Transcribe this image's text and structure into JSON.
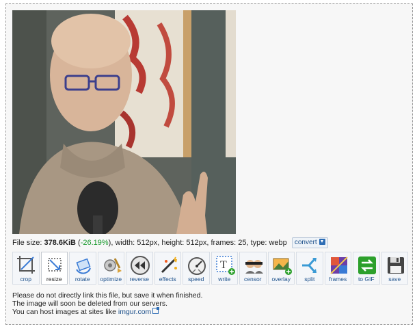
{
  "file_info": {
    "prefix": "File size: ",
    "size": "378.6KiB",
    "paren_open": " (",
    "percent": "-26.19%",
    "rest": "), width: 512px, height: 512px, frames: 25, type: webp"
  },
  "convert_label": "convert",
  "tools": [
    {
      "label": "crop",
      "icon": "crop-icon"
    },
    {
      "label": "resize",
      "icon": "resize-icon"
    },
    {
      "label": "rotate",
      "icon": "rotate-icon"
    },
    {
      "label": "optimize",
      "icon": "optimize-icon"
    },
    {
      "label": "reverse",
      "icon": "reverse-icon"
    },
    {
      "label": "effects",
      "icon": "effects-icon"
    },
    {
      "label": "speed",
      "icon": "speed-icon"
    },
    {
      "label": "write",
      "icon": "write-icon"
    },
    {
      "label": "censor",
      "icon": "censor-icon"
    },
    {
      "label": "overlay",
      "icon": "overlay-icon"
    },
    {
      "label": "split",
      "icon": "split-icon"
    },
    {
      "label": "frames",
      "icon": "frames-icon"
    },
    {
      "label": "to GIF",
      "icon": "to-gif-icon"
    },
    {
      "label": "save",
      "icon": "save-icon"
    }
  ],
  "active_tool": "resize",
  "notes": {
    "line1": "Please do not directly link this file, but save it when finished.",
    "line2": "The image will soon be deleted from our servers.",
    "line3_prefix": "You can host images at sites like ",
    "link": "imgur.com"
  },
  "colors": {
    "percent": "#1a9a2e",
    "link": "#1b4f8a"
  }
}
